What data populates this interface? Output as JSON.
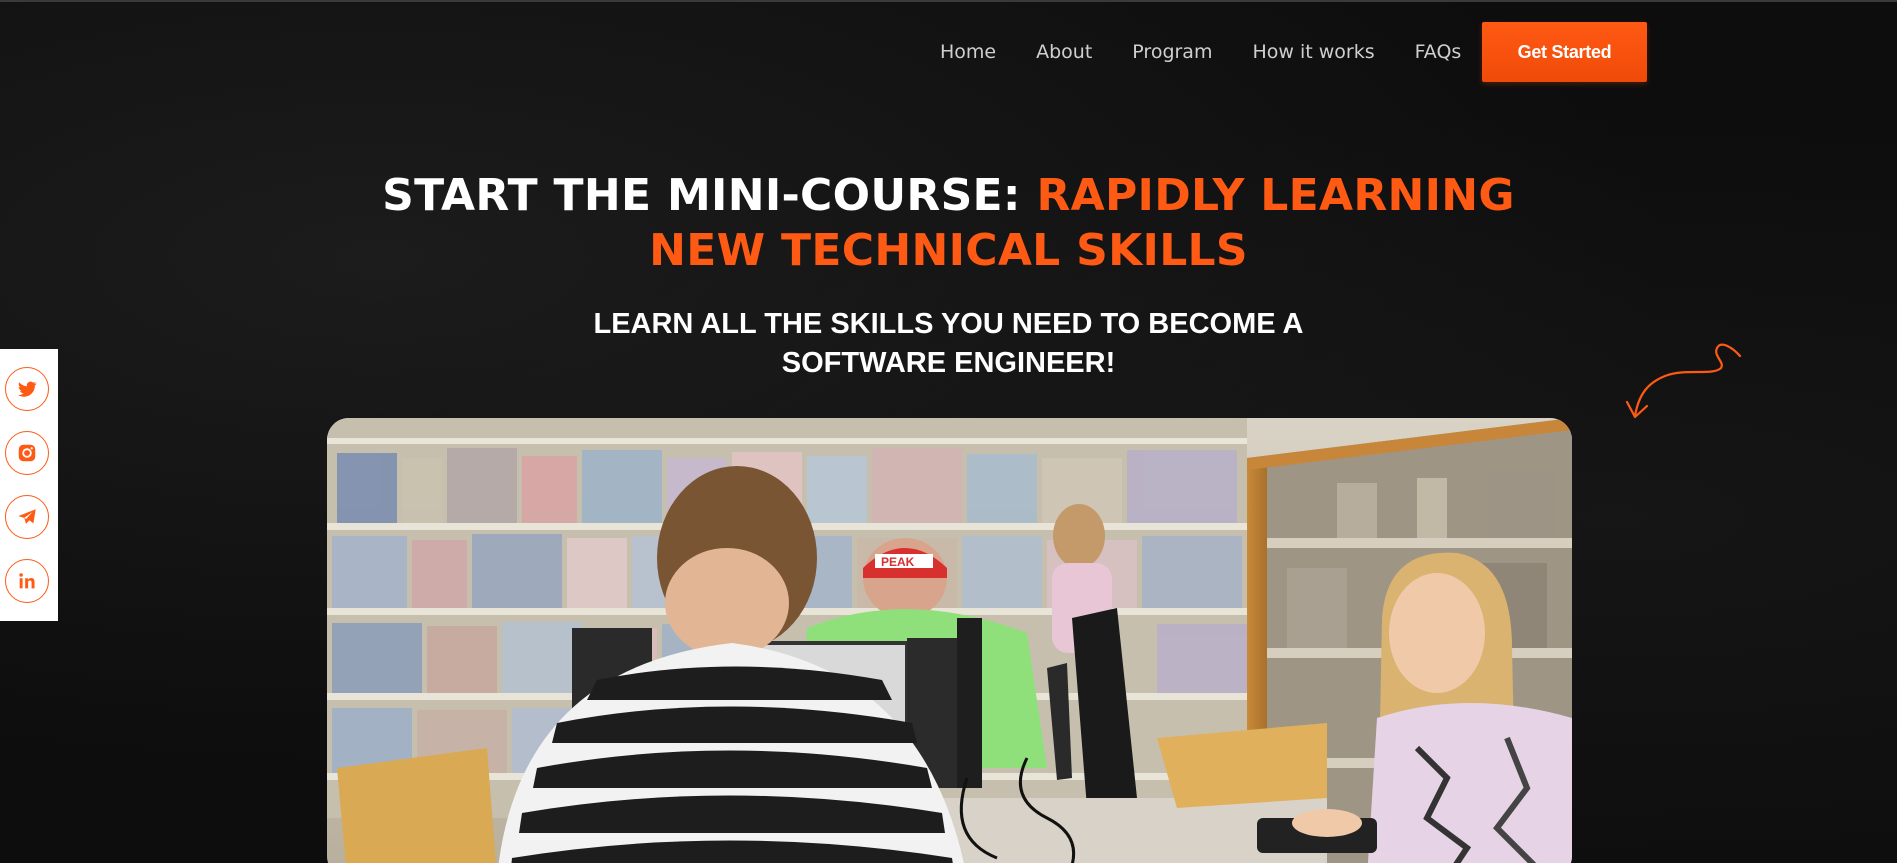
{
  "nav": {
    "items": [
      {
        "label": "Home"
      },
      {
        "label": "About"
      },
      {
        "label": "Program"
      },
      {
        "label": "How it works"
      },
      {
        "label": "FAQs"
      }
    ],
    "cta_label": "Get Started"
  },
  "hero": {
    "title_white": "START THE MINI-COURSE: ",
    "title_orange_1": "RAPIDLY LEARNING",
    "title_orange_2": "NEW TECHNICAL SKILLS",
    "subtitle_line1": "LEARN ALL THE SKILLS YOU NEED TO BECOME A",
    "subtitle_line2": "SOFTWARE ENGINEER!"
  },
  "social": {
    "icons": [
      "twitter-icon",
      "instagram-icon",
      "telegram-icon",
      "linkedin-icon"
    ]
  },
  "media": {
    "sign_text": "PEAK"
  },
  "colors": {
    "accent": "#ff5a14",
    "background": "#0d0d0d",
    "text": "#ffffff",
    "nav_text": "#cfcfcf"
  }
}
